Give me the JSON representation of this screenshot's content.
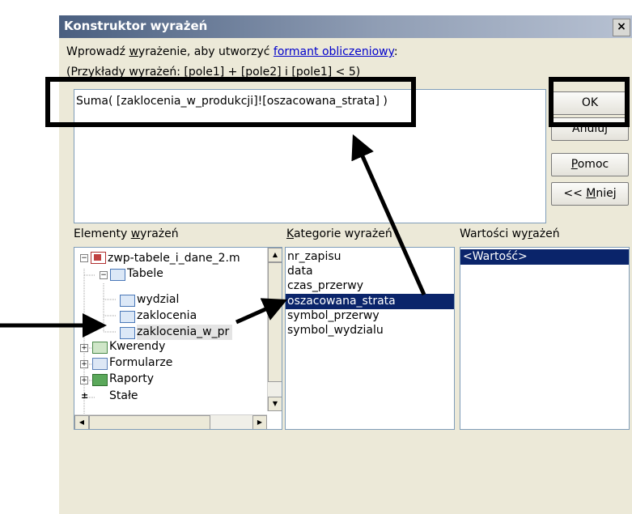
{
  "window": {
    "title": "Konstruktor wyrażeń",
    "close": "×"
  },
  "instructions": {
    "line1_prefix": "Wprowadź ",
    "line1_underlined": "w",
    "line1_middle": "yrażenie, aby utworzyć ",
    "line1_link": "formant obliczeniowy",
    "line1_suffix": ":",
    "line2": "(Przykłady wyrażeń: [pole1] + [pole2] i [pole1] < 5)"
  },
  "expression": {
    "value": "Suma( [zaklocenia_w_produkcji]![oszacowana_strata] )"
  },
  "buttons": {
    "ok": "OK",
    "cancel": "Anuluj",
    "help_underlined": "P",
    "help_rest": "omoc",
    "less_prefix": "<< ",
    "less_underlined": "M",
    "less_rest": "niej"
  },
  "elements_panel": {
    "label_prefix": "Elementy ",
    "label_underlined": "w",
    "label_rest": "yrażeń",
    "tree": {
      "root": "zwp-tabele_i_dane_2.m",
      "tables": "Tabele",
      "table_items": [
        "wydzial",
        "zaklocenia",
        "zaklocenia_w_pr"
      ],
      "queries": "Kwerendy",
      "forms": "Formularze",
      "reports": "Raporty",
      "constants": "Stałe"
    }
  },
  "categories_panel": {
    "label_underlined": "K",
    "label_rest": "ategorie wyrażeń",
    "items": [
      "nr_zapisu",
      "data",
      "czas_przerwy",
      "oszacowana_strata",
      "symbol_przerwy",
      "symbol_wydzialu"
    ],
    "selected_index": 3
  },
  "values_panel": {
    "label_prefix": "Wartości wy",
    "label_underlined": "r",
    "label_rest": "ażeń",
    "items": [
      "<Wartość>"
    ]
  },
  "colors": {
    "selection": "#0a246a",
    "link": "#0000cc",
    "dialog_bg": "#ece9d8"
  }
}
